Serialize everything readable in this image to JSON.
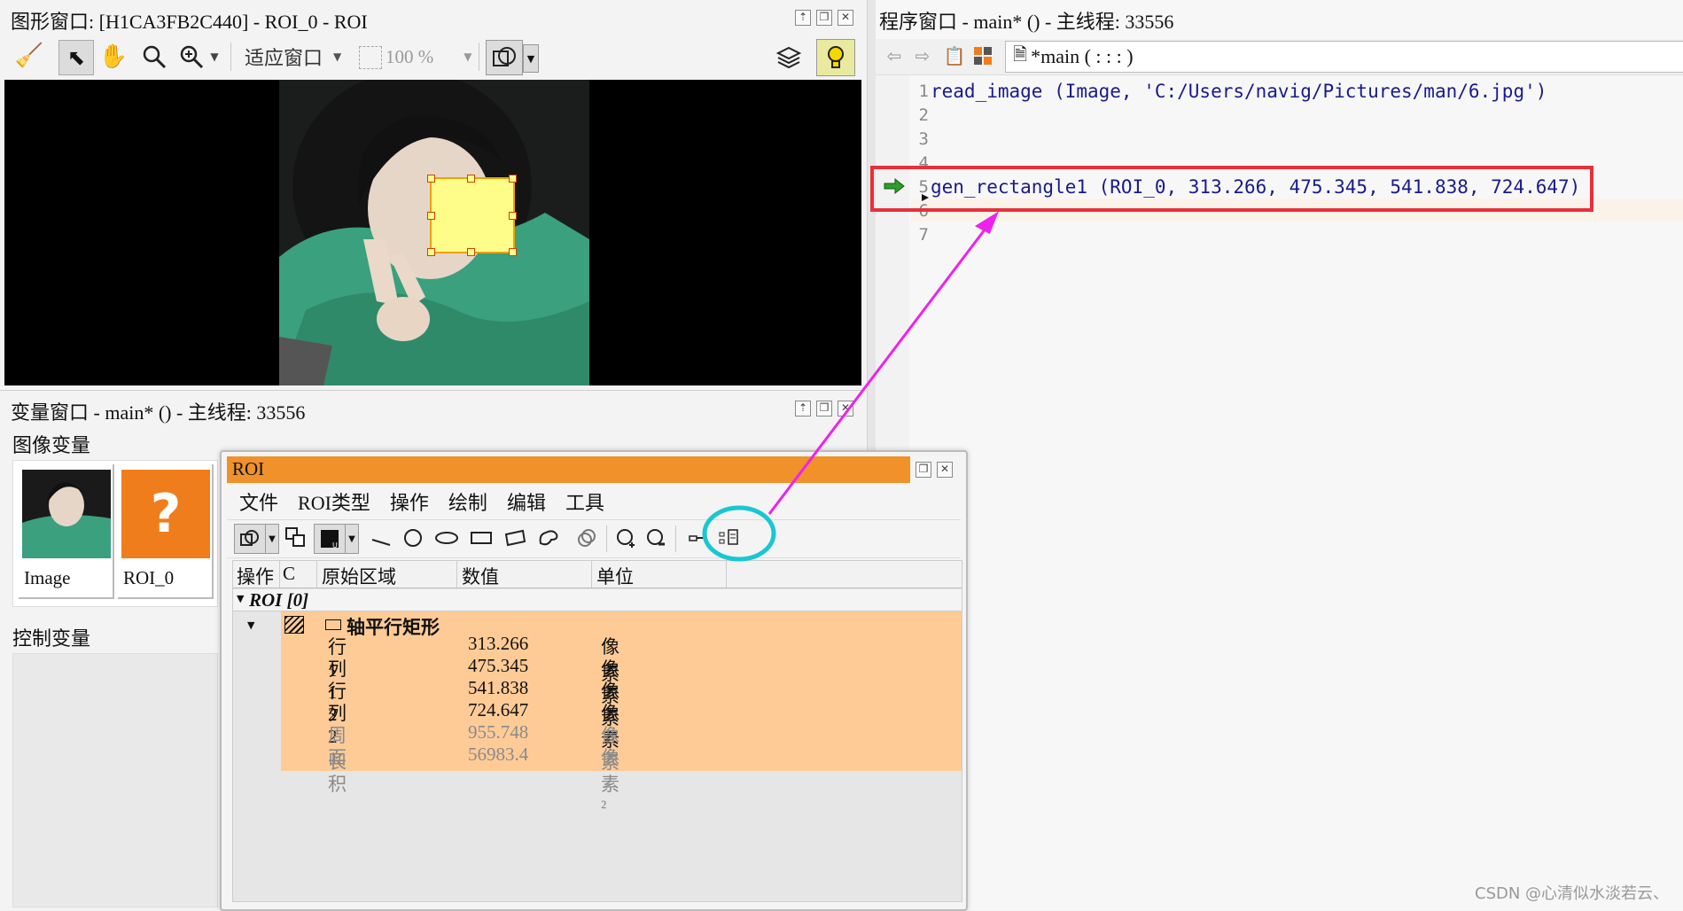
{
  "graphics_window": {
    "title": "图形窗口: [H1CA3FB2C440] - ROI_0 - ROI",
    "zoom_mode": "适应窗口",
    "zoom_percent": "100 %"
  },
  "program_window": {
    "title": "程序窗口 - main* () - 主线程: 33556",
    "proc_selector": "*main ( : : : )",
    "line_numbers": [
      "1",
      "2",
      "3",
      "4",
      "5",
      "6",
      "7"
    ],
    "lines": [
      "read_image (Image, 'C:/Users/navig/Pictures/man/6.jpg')",
      "gen_rectangle1 (ROI_0, 313.266, 475.345, 541.838, 724.647)"
    ]
  },
  "variable_window": {
    "title": "变量窗口 - main* () - 主线程: 33556",
    "image_vars_label": "图像变量",
    "image_vars": [
      {
        "name": "Image"
      },
      {
        "name": "ROI_0",
        "placeholder": "?"
      }
    ],
    "control_vars_label": "控制变量"
  },
  "roi_dialog": {
    "title": "ROI",
    "menu": [
      "文件",
      "ROI类型",
      "操作",
      "绘制",
      "编辑",
      "工具"
    ],
    "columns": [
      "操作",
      "C",
      "原始区域",
      "数值",
      "单位"
    ],
    "group": "ROI [0]",
    "shape": "轴平行矩形",
    "properties": [
      {
        "name": "行1",
        "value": "313.266",
        "unit": "像素",
        "muted": false
      },
      {
        "name": "列1",
        "value": "475.345",
        "unit": "像素",
        "muted": false
      },
      {
        "name": "行2",
        "value": "541.838",
        "unit": "像素",
        "muted": false
      },
      {
        "name": "列2",
        "value": "724.647",
        "unit": "像素",
        "muted": false
      },
      {
        "name": "周长",
        "value": "955.748",
        "unit": "像素",
        "muted": true
      },
      {
        "name": "面积",
        "value": "56983.4",
        "unit": "像素²",
        "muted": true
      }
    ]
  },
  "watermark": "CSDN @心清似水淡若云、",
  "colors": {
    "roi_title_bg": "#f0912a",
    "roi_table_bg": "#fecb97",
    "roi_rect_fill": "#fffd8a",
    "highlight_red": "#e8303a",
    "arrow_magenta": "#ee22ee",
    "circle_cyan": "#19c7d2",
    "code_blue": "#1a1a8c"
  }
}
